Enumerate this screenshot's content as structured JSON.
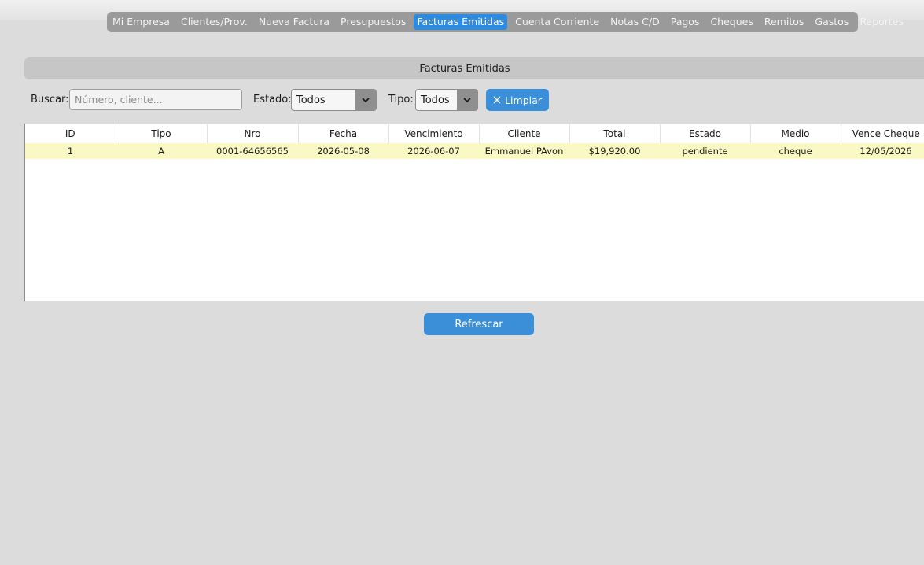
{
  "nav": {
    "tabs": [
      {
        "label": "Mi Empresa",
        "active": false
      },
      {
        "label": "Clientes/Prov.",
        "active": false
      },
      {
        "label": "Nueva Factura",
        "active": false
      },
      {
        "label": "Presupuestos",
        "active": false
      },
      {
        "label": "Facturas Emitidas",
        "active": true
      },
      {
        "label": "Cuenta Corriente",
        "active": false
      },
      {
        "label": "Notas C/D",
        "active": false
      },
      {
        "label": "Pagos",
        "active": false
      },
      {
        "label": "Cheques",
        "active": false
      },
      {
        "label": "Remitos",
        "active": false
      },
      {
        "label": "Gastos",
        "active": false
      },
      {
        "label": "Reportes",
        "active": false
      }
    ]
  },
  "panel": {
    "title": "Facturas Emitidas"
  },
  "filters": {
    "search_label": "Buscar:",
    "search_placeholder": "Número, cliente...",
    "search_value": "",
    "estado_label": "Estado:",
    "estado_value": "Todos",
    "tipo_label": "Tipo:",
    "tipo_value": "Todos",
    "clear_label": "Limpiar",
    "clear_icon": "close-icon",
    "dropdown_icon": "chevron-down-icon"
  },
  "table": {
    "columns": [
      "ID",
      "Tipo",
      "Nro",
      "Fecha",
      "Vencimiento",
      "Cliente",
      "Total",
      "Estado",
      "Medio",
      "Vence Cheque"
    ],
    "rows": [
      [
        "1",
        "A",
        "0001-64656565",
        "2026-05-08",
        "2026-06-07",
        "Emmanuel PAvon",
        "$19,920.00",
        "pendiente",
        "cheque",
        "12/05/2026"
      ]
    ],
    "highlight_color": "#fbf9c3"
  },
  "actions": {
    "refresh_label": "Refrescar"
  },
  "colors": {
    "accent": "#3a8fd8",
    "tabbar": "#9a9a9a",
    "background": "#dcdcdc"
  }
}
